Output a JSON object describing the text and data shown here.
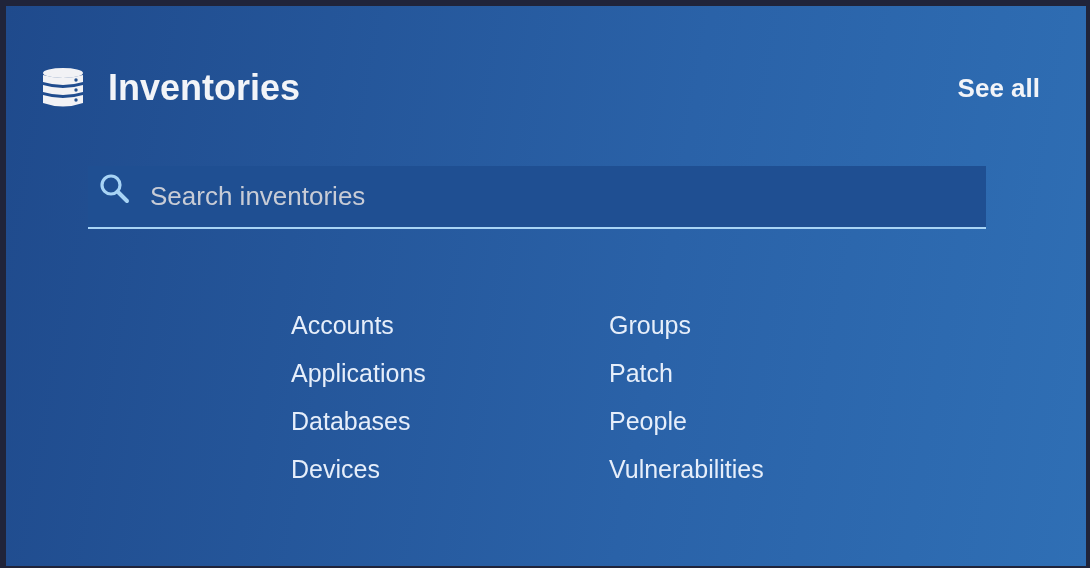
{
  "header": {
    "title": "Inventories",
    "see_all": "See all"
  },
  "search": {
    "placeholder": "Search inventories"
  },
  "link_columns": [
    [
      "Accounts",
      "Applications",
      "Databases",
      "Devices"
    ],
    [
      "Groups",
      "Patch",
      "People",
      "Vulnerabilities"
    ]
  ]
}
